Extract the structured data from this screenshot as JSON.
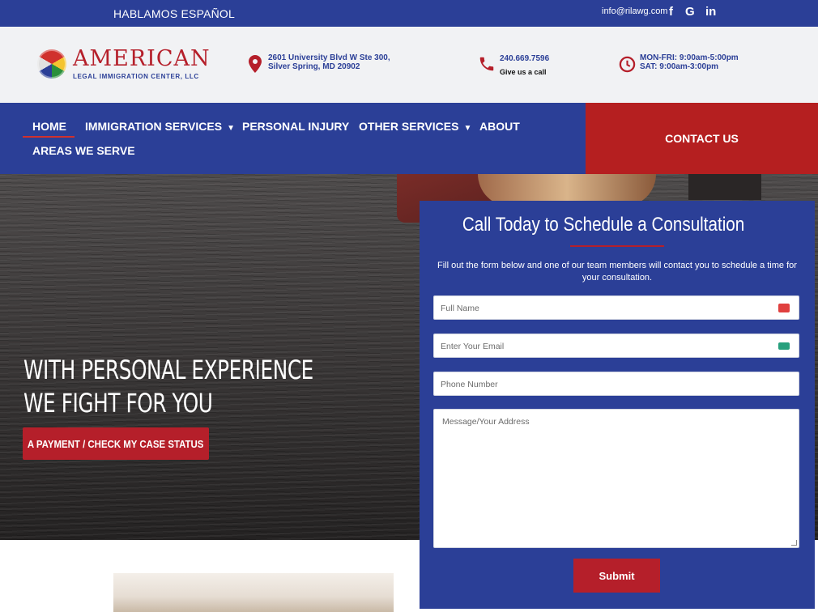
{
  "topbar": {
    "language": "HABLAMOS ESPAÑOL",
    "email": "info@rilawg.com",
    "social": [
      "facebook-icon",
      "google-icon",
      "linkedin-icon"
    ],
    "social_glyphs": {
      "facebook": "f",
      "google": "G",
      "linkedin": "in"
    }
  },
  "header": {
    "logo_main": "AMERICAN",
    "logo_sub": "LEGAL IMMIGRATION CENTER, LLC",
    "address_line1": "2601 University Blvd W Ste 300,",
    "address_line2": "Silver Spring, MD 20902",
    "phone": "240.669.7596",
    "phone_sub": "Give us a call",
    "hours_line1": "MON-FRI: 9:00am-5:00pm",
    "hours_line2": "SAT: 9:00am-3:00pm"
  },
  "nav": {
    "items": [
      {
        "label": "HOME",
        "active": true
      },
      {
        "label": "IMMIGRATION SERVICES",
        "dropdown": true
      },
      {
        "label": "PERSONAL INJURY"
      },
      {
        "label": "OTHER SERVICES",
        "dropdown": true
      },
      {
        "label": "ABOUT"
      },
      {
        "label": "AREAS WE SERVE"
      }
    ],
    "contact": "CONTACT US"
  },
  "hero": {
    "title_line1": "WITH PERSONAL EXPERIENCE",
    "title_line2": "WE FIGHT FOR YOU",
    "button": "A PAYMENT / CHECK MY CASE STATUS"
  },
  "form": {
    "title": "Call Today to Schedule a Consultation",
    "description": "Fill out the form below and one of our team members will contact you to schedule a time for your consultation.",
    "fields": {
      "full_name": "Full Name",
      "email": "Enter Your Email",
      "phone": "Phone Number",
      "message": "Message/Your Address"
    },
    "submit": "Submit"
  },
  "colors": {
    "brand_blue": "#2b3f97",
    "brand_red": "#b51f2a",
    "contact_red": "#b51f20"
  }
}
